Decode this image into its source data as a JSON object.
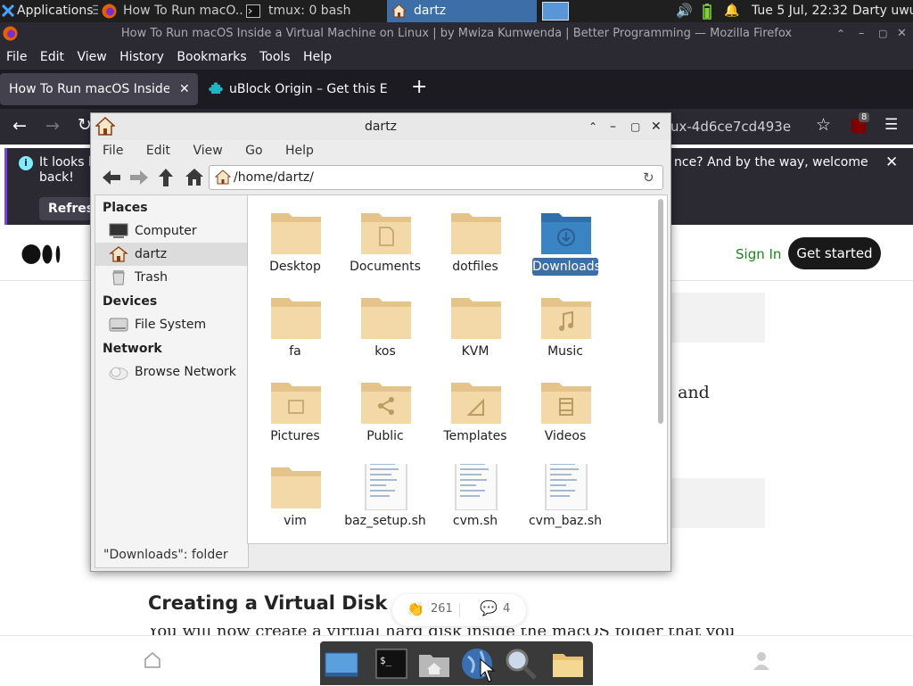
{
  "panel": {
    "applications": "Applications",
    "task_firefox": "How To Run macO...",
    "task_tmux": "tmux: 0 bash",
    "task_dartz": "dartz",
    "clock": "Tue  5 Jul, 22:32",
    "user": "Darty uwu"
  },
  "firefox": {
    "window_title": "How To Run macOS Inside a Virtual Machine on Linux | by Mwiza Kumwenda | Better Programming — Mozilla Firefox",
    "menu": [
      "File",
      "Edit",
      "View",
      "History",
      "Bookmarks",
      "Tools",
      "Help"
    ],
    "tabs": [
      {
        "label": "How To Run macOS Inside a"
      },
      {
        "label": "uBlock Origin – Get this E"
      }
    ],
    "url_fragment": "ux-4d6ce7cd493e",
    "ublock_badge": "8",
    "notice_line1": "It looks l",
    "notice_line1_end": "nce? And by the way, welcome",
    "notice_line2": "back!",
    "refresh_label": "Refres"
  },
  "page": {
    "sign_in": "Sign In",
    "get_started": "Get started",
    "fragment_and": ", and",
    "heading": "Creating a Virtual Disk",
    "body_fragment": "You will now create a virtual hard disk inside the macOS folder that you have",
    "claps": "261",
    "responses": "4"
  },
  "file_manager": {
    "title": "dartz",
    "menu": [
      "File",
      "Edit",
      "View",
      "Go",
      "Help"
    ],
    "path": "/home/dartz/",
    "places_header": "Places",
    "devices_header": "Devices",
    "network_header": "Network",
    "places": [
      {
        "label": "Computer"
      },
      {
        "label": "dartz"
      },
      {
        "label": "Trash"
      }
    ],
    "devices": [
      {
        "label": "File System"
      }
    ],
    "network": [
      {
        "label": "Browse Network"
      }
    ],
    "items": [
      {
        "label": "Desktop"
      },
      {
        "label": "Documents"
      },
      {
        "label": "dotfiles"
      },
      {
        "label": "Downloads"
      },
      {
        "label": "fa"
      },
      {
        "label": "kos"
      },
      {
        "label": "KVM"
      },
      {
        "label": "Music"
      },
      {
        "label": "Pictures"
      },
      {
        "label": "Public"
      },
      {
        "label": "Templates"
      },
      {
        "label": "Videos"
      },
      {
        "label": "vim"
      },
      {
        "label": "baz_setup.sh"
      },
      {
        "label": "cvm.sh"
      },
      {
        "label": "cvm_baz.sh"
      }
    ],
    "status": "\"Downloads\": folder"
  },
  "colors": {
    "accent": "#3d6ea8",
    "folder": "#f0cf95",
    "folder_selected": "#3b84c4"
  }
}
